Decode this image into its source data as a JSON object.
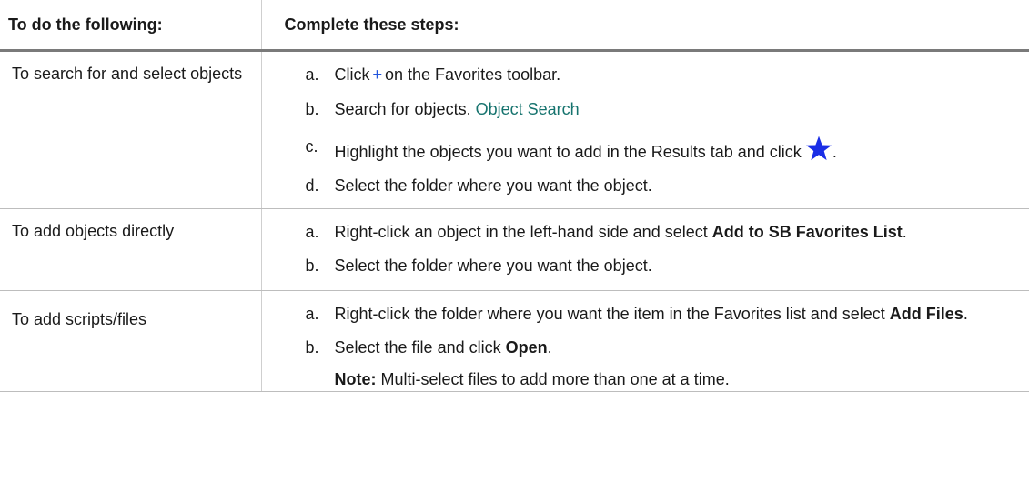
{
  "table": {
    "header": {
      "col1": "To do the following:",
      "col2": "Complete these steps:"
    },
    "rows": [
      {
        "task": "To search for and select objects",
        "steps": [
          {
            "marker": "a.",
            "pre": "Click",
            "post": "on the Favorites toolbar."
          },
          {
            "marker": "b.",
            "text": "Search for objects.",
            "link": "Object Search"
          },
          {
            "marker": "c.",
            "text": "Highlight the objects you want to add in the Results tab and click",
            "post": "."
          },
          {
            "marker": "d.",
            "text": "Select the folder where you want the object."
          }
        ]
      },
      {
        "task": "To add objects directly",
        "steps": [
          {
            "marker": "a.",
            "text": "Right-click an object in the left-hand side and select",
            "bold": "Add to SB Favorites List",
            "post": "."
          },
          {
            "marker": "b.",
            "text": "Select the folder where you want the object."
          }
        ]
      },
      {
        "task": "To add scripts/files",
        "steps": [
          {
            "marker": "a.",
            "text": "Right-click the folder where you want the item in the Favorites list and select",
            "bold": "Add Files",
            "post": "."
          },
          {
            "marker": "b.",
            "text": "Select the file and click",
            "bold": "Open",
            "post": "."
          }
        ],
        "note": {
          "label": "Note:",
          "text": "Multi-select files to add more than one at a time."
        }
      }
    ]
  },
  "icons": {
    "plus": "+",
    "star_color": "#1a2ee6"
  }
}
